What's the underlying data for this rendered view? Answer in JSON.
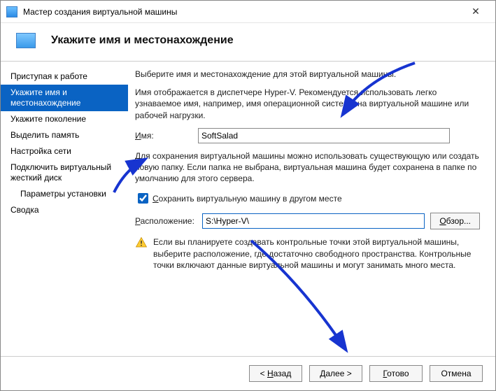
{
  "window": {
    "title": "Мастер создания виртуальной машины"
  },
  "header": {
    "heading": "Укажите имя и местонахождение"
  },
  "sidebar": {
    "items": [
      {
        "label": "Приступая к работе"
      },
      {
        "label": "Укажите имя и местонахождение"
      },
      {
        "label": "Укажите поколение"
      },
      {
        "label": "Выделить память"
      },
      {
        "label": "Настройка сети"
      },
      {
        "label": "Подключить виртуальный жесткий диск"
      },
      {
        "label": "Параметры установки"
      },
      {
        "label": "Сводка"
      }
    ]
  },
  "content": {
    "intro": "Выберите имя и местонахождение для этой виртуальной машины.",
    "desc": "Имя отображается в диспетчере Hyper-V. Рекомендуется использовать легко узнаваемое имя, например, имя операционной системы на виртуальной машине или рабочей нагрузки.",
    "name_label_pre": "И",
    "name_label_post": "мя:",
    "name_value": "SoftSalad",
    "storage_desc": "Для сохранения виртуальной машины можно использовать существующую или создать новую папку. Если папка не выбрана, виртуальная машина будет сохранена в папке по умолчанию для этого сервера.",
    "store_check_pre": "С",
    "store_check_post": "охранить виртуальную машину в другом месте",
    "store_checked": true,
    "loc_label_pre": "Р",
    "loc_label_post": "асположение:",
    "loc_value": "S:\\Hyper-V\\",
    "browse_pre": "О",
    "browse_post": "бзор...",
    "warning": "Если вы планируете создавать контрольные точки этой виртуальной машины, выберите расположение, где достаточно свободного пространства. Контрольные точки включают данные виртуальной машины и могут занимать много места."
  },
  "footer": {
    "back_pre": "< ",
    "back_u": "Н",
    "back_post": "азад",
    "next_pre": "",
    "next_u": "Д",
    "next_post": "алее >",
    "finish_pre": "",
    "finish_u": "Г",
    "finish_post": "отово",
    "cancel": "Отмена"
  }
}
